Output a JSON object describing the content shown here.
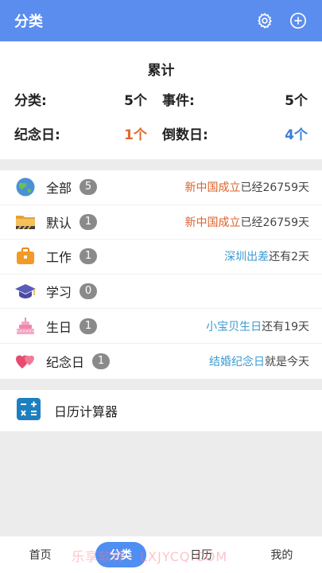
{
  "header": {
    "title": "分类",
    "icons": [
      "gear-icon",
      "plus-circle-icon"
    ]
  },
  "summary": {
    "title": "累计",
    "category_label": "分类:",
    "category_value": "5个",
    "event_label": "事件:",
    "event_value": "5个",
    "anniversary_label": "纪念日:",
    "anniversary_value": "1个",
    "countdown_label": "倒数日:",
    "countdown_value": "4个"
  },
  "categories": [
    {
      "icon": "globe-icon",
      "name": "全部",
      "count": "5",
      "event": "新中国成立",
      "event_color": "orange",
      "status": "已经26759天"
    },
    {
      "icon": "folder-icon",
      "name": "默认",
      "count": "1",
      "event": "新中国成立",
      "event_color": "orange",
      "status": "已经26759天"
    },
    {
      "icon": "briefcase-icon",
      "name": "工作",
      "count": "1",
      "event": "深圳出差",
      "event_color": "blue",
      "status": "还有2天"
    },
    {
      "icon": "graduation-cap-icon",
      "name": "学习",
      "count": "0",
      "event": "",
      "event_color": "",
      "status": ""
    },
    {
      "icon": "cake-icon",
      "name": "生日",
      "count": "1",
      "event": "小宝贝生日",
      "event_color": "blue",
      "status": "还有19天"
    },
    {
      "icon": "hearts-icon",
      "name": "纪念日",
      "count": "1",
      "event": "结婚纪念日",
      "event_color": "blue",
      "status": "就是今天"
    }
  ],
  "calculator": {
    "icon": "calculator-icon",
    "label": "日历计算器"
  },
  "nav": {
    "tabs": [
      "首页",
      "分类",
      "日历",
      "我的"
    ],
    "active": 1
  },
  "watermark": "乐享软件 · LXJYCQ.COM",
  "colors": {
    "accent": "#5b8def",
    "orange": "#e0692a",
    "blue": "#3d7fd6"
  }
}
